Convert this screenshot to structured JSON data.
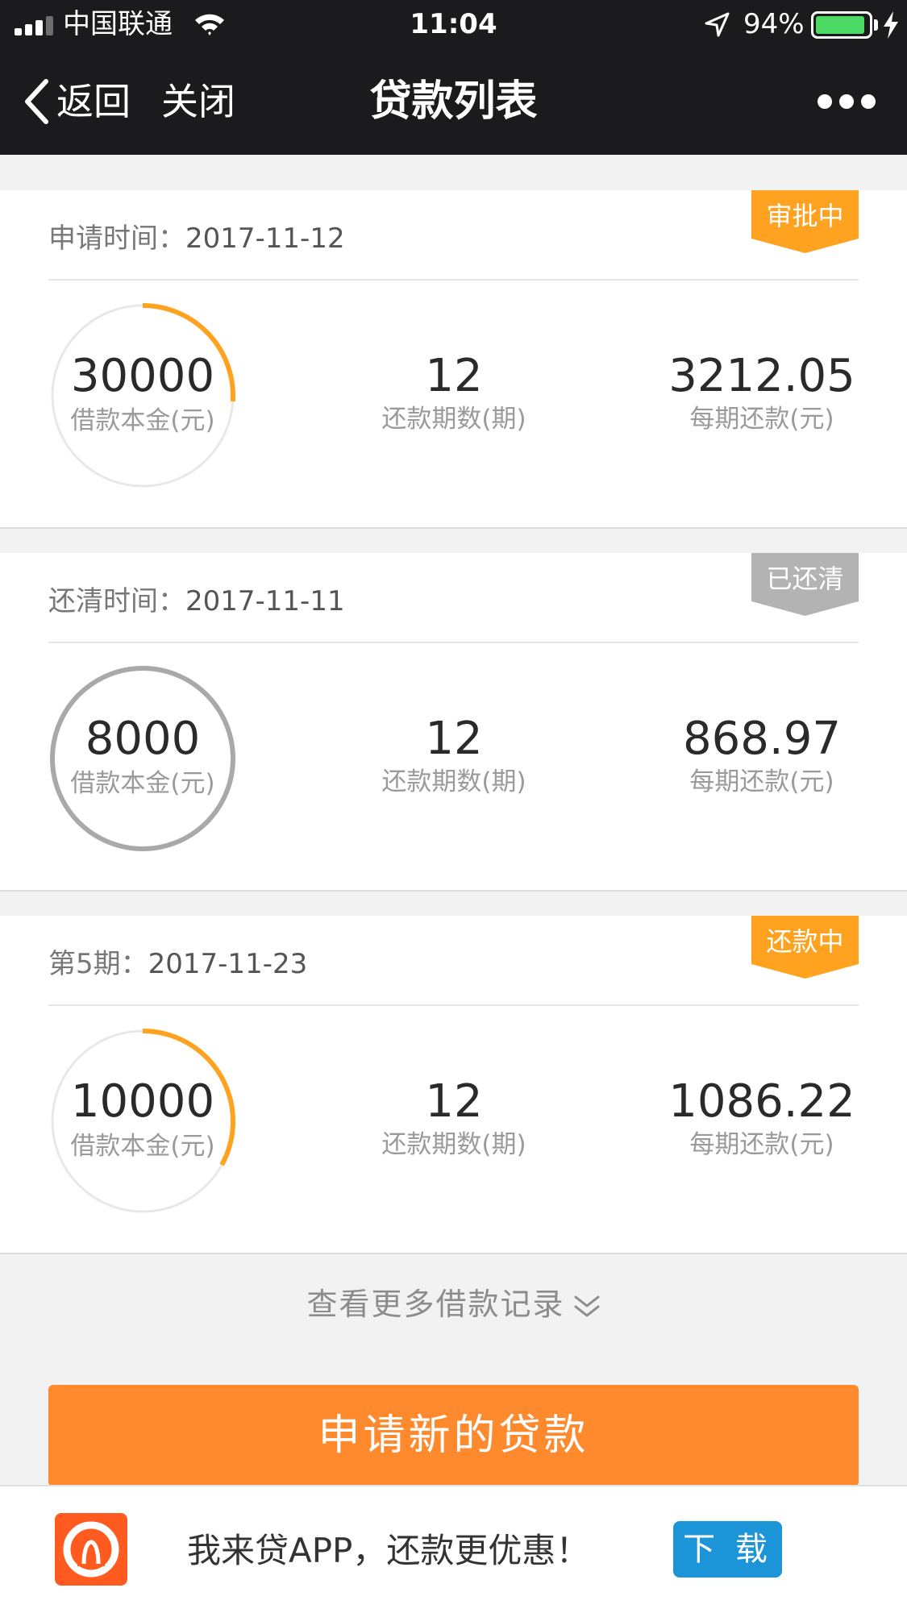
{
  "status_bar": {
    "carrier": "中国联通",
    "time": "11:04",
    "battery_percent": "94%",
    "battery_level": 0.94,
    "icons": [
      "signal-icon",
      "wifi-icon",
      "location-icon",
      "battery-icon",
      "charging-icon"
    ]
  },
  "nav": {
    "back_label": "返回",
    "close_label": "关闭",
    "title": "贷款列表",
    "more_icon": "more-dots-icon"
  },
  "loans": [
    {
      "date_label": "申请时间：",
      "date": "2017-11-12",
      "status": "审批中",
      "status_color": "#ffa21f",
      "principal": "30000",
      "principal_label": "借款本金(元)",
      "periods": "12",
      "periods_label": "还款期数(期)",
      "payment": "3212.05",
      "payment_label": "每期还款(元)",
      "ring_progress": 0.26,
      "ring_color": "#ffa21f"
    },
    {
      "date_label": "还清时间：",
      "date": "2017-11-11",
      "status": "已还清",
      "status_color": "#b3b3b3",
      "principal": "8000",
      "principal_label": "借款本金(元)",
      "periods": "12",
      "periods_label": "还款期数(期)",
      "payment": "868.97",
      "payment_label": "每期还款(元)",
      "ring_progress": 1.0,
      "ring_color": "#a9a9a9"
    },
    {
      "date_label": "第5期：",
      "date": "2017-11-23",
      "status": "还款中",
      "status_color": "#ffa21f",
      "principal": "10000",
      "principal_label": "借款本金(元)",
      "periods": "12",
      "periods_label": "还款期数(期)",
      "payment": "1086.22",
      "payment_label": "每期还款(元)",
      "ring_progress": 0.33,
      "ring_color": "#ffa21f"
    }
  ],
  "more_records": {
    "label": "查看更多借款记录",
    "icon": "double-chevron-down-icon"
  },
  "apply_button": {
    "label": "申请新的贷款",
    "color": "#ff8a2e"
  },
  "app_banner": {
    "slogan": "我来贷APP，还款更优惠！",
    "download_label": "下 载",
    "download_color": "#1b95d7",
    "logo_icon": "wolaidai-logo-icon"
  }
}
